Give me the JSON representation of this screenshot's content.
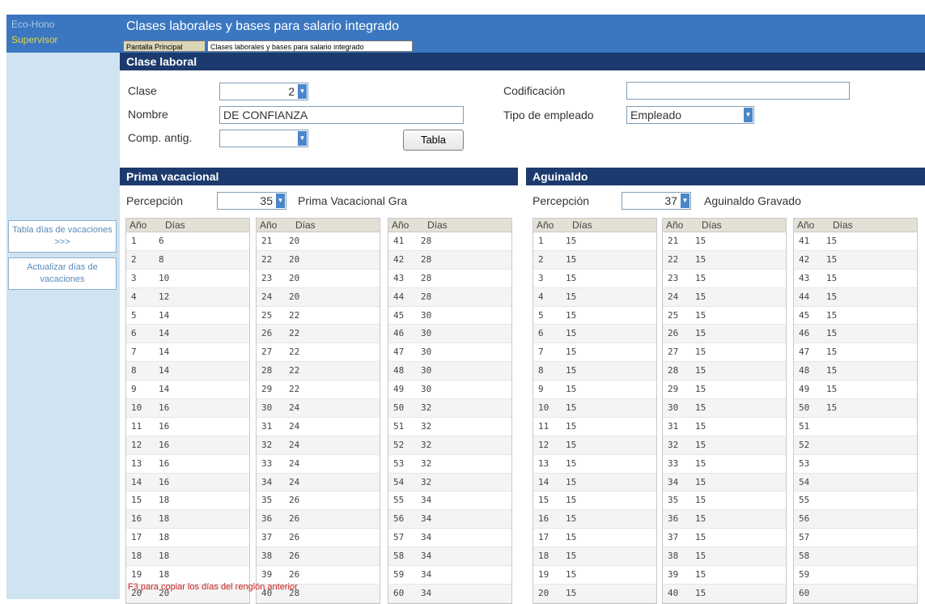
{
  "sidebar": {
    "app_name": "Eco-Hono",
    "user_role": "Supervisor",
    "buttons": [
      "Tabla días de vacaciones >>>",
      "Actualizar días de vacaciones"
    ]
  },
  "window": {
    "title": "Clases laborales y bases para salario integrado",
    "tabs": [
      "Pantalla Principal",
      "Clases laborales y bases para salario integrado"
    ]
  },
  "clase_laboral": {
    "header": "Clase laboral",
    "labels": {
      "clase": "Clase",
      "nombre": "Nombre",
      "comp_antig": "Comp. antig.",
      "codificacion": "Codificación",
      "tipo_empleado": "Tipo de empleado"
    },
    "values": {
      "clase": "2",
      "nombre": "DE CONFIANZA",
      "comp_antig": "",
      "codificacion": "",
      "tipo_empleado": "Empleado"
    },
    "tabla_button": "Tabla"
  },
  "prima_vacacional": {
    "header": "Prima vacacional",
    "percepcion_label": "Percepción",
    "percepcion_value": "35",
    "percepcion_name": "Prima Vacacional Gra",
    "col_headers": [
      "Año",
      "Días"
    ],
    "columns": [
      [
        [
          "1",
          "6"
        ],
        [
          "2",
          "8"
        ],
        [
          "3",
          "10"
        ],
        [
          "4",
          "12"
        ],
        [
          "5",
          "14"
        ],
        [
          "6",
          "14"
        ],
        [
          "7",
          "14"
        ],
        [
          "8",
          "14"
        ],
        [
          "9",
          "14"
        ],
        [
          "10",
          "16"
        ],
        [
          "11",
          "16"
        ],
        [
          "12",
          "16"
        ],
        [
          "13",
          "16"
        ],
        [
          "14",
          "16"
        ],
        [
          "15",
          "18"
        ],
        [
          "16",
          "18"
        ],
        [
          "17",
          "18"
        ],
        [
          "18",
          "18"
        ],
        [
          "19",
          "18"
        ],
        [
          "20",
          "20"
        ]
      ],
      [
        [
          "21",
          "20"
        ],
        [
          "22",
          "20"
        ],
        [
          "23",
          "20"
        ],
        [
          "24",
          "20"
        ],
        [
          "25",
          "22"
        ],
        [
          "26",
          "22"
        ],
        [
          "27",
          "22"
        ],
        [
          "28",
          "22"
        ],
        [
          "29",
          "22"
        ],
        [
          "30",
          "24"
        ],
        [
          "31",
          "24"
        ],
        [
          "32",
          "24"
        ],
        [
          "33",
          "24"
        ],
        [
          "34",
          "24"
        ],
        [
          "35",
          "26"
        ],
        [
          "36",
          "26"
        ],
        [
          "37",
          "26"
        ],
        [
          "38",
          "26"
        ],
        [
          "39",
          "26"
        ],
        [
          "40",
          "28"
        ]
      ],
      [
        [
          "41",
          "28"
        ],
        [
          "42",
          "28"
        ],
        [
          "43",
          "28"
        ],
        [
          "44",
          "28"
        ],
        [
          "45",
          "30"
        ],
        [
          "46",
          "30"
        ],
        [
          "47",
          "30"
        ],
        [
          "48",
          "30"
        ],
        [
          "49",
          "30"
        ],
        [
          "50",
          "32"
        ],
        [
          "51",
          "32"
        ],
        [
          "52",
          "32"
        ],
        [
          "53",
          "32"
        ],
        [
          "54",
          "32"
        ],
        [
          "55",
          "34"
        ],
        [
          "56",
          "34"
        ],
        [
          "57",
          "34"
        ],
        [
          "58",
          "34"
        ],
        [
          "59",
          "34"
        ],
        [
          "60",
          "34"
        ]
      ]
    ]
  },
  "aguinaldo": {
    "header": "Aguinaldo",
    "percepcion_label": "Percepción",
    "percepcion_value": "37",
    "percepcion_name": "Aguinaldo Gravado",
    "col_headers": [
      "Año",
      "Días"
    ],
    "columns": [
      [
        [
          "1",
          "15"
        ],
        [
          "2",
          "15"
        ],
        [
          "3",
          "15"
        ],
        [
          "4",
          "15"
        ],
        [
          "5",
          "15"
        ],
        [
          "6",
          "15"
        ],
        [
          "7",
          "15"
        ],
        [
          "8",
          "15"
        ],
        [
          "9",
          "15"
        ],
        [
          "10",
          "15"
        ],
        [
          "11",
          "15"
        ],
        [
          "12",
          "15"
        ],
        [
          "13",
          "15"
        ],
        [
          "14",
          "15"
        ],
        [
          "15",
          "15"
        ],
        [
          "16",
          "15"
        ],
        [
          "17",
          "15"
        ],
        [
          "18",
          "15"
        ],
        [
          "19",
          "15"
        ],
        [
          "20",
          "15"
        ]
      ],
      [
        [
          "21",
          "15"
        ],
        [
          "22",
          "15"
        ],
        [
          "23",
          "15"
        ],
        [
          "24",
          "15"
        ],
        [
          "25",
          "15"
        ],
        [
          "26",
          "15"
        ],
        [
          "27",
          "15"
        ],
        [
          "28",
          "15"
        ],
        [
          "29",
          "15"
        ],
        [
          "30",
          "15"
        ],
        [
          "31",
          "15"
        ],
        [
          "32",
          "15"
        ],
        [
          "33",
          "15"
        ],
        [
          "34",
          "15"
        ],
        [
          "35",
          "15"
        ],
        [
          "36",
          "15"
        ],
        [
          "37",
          "15"
        ],
        [
          "38",
          "15"
        ],
        [
          "39",
          "15"
        ],
        [
          "40",
          "15"
        ]
      ],
      [
        [
          "41",
          "15"
        ],
        [
          "42",
          "15"
        ],
        [
          "43",
          "15"
        ],
        [
          "44",
          "15"
        ],
        [
          "45",
          "15"
        ],
        [
          "46",
          "15"
        ],
        [
          "47",
          "15"
        ],
        [
          "48",
          "15"
        ],
        [
          "49",
          "15"
        ],
        [
          "50",
          "15"
        ],
        [
          "51",
          ""
        ],
        [
          "52",
          ""
        ],
        [
          "53",
          ""
        ],
        [
          "54",
          ""
        ],
        [
          "55",
          ""
        ],
        [
          "56",
          ""
        ],
        [
          "57",
          ""
        ],
        [
          "58",
          ""
        ],
        [
          "59",
          ""
        ],
        [
          "60",
          ""
        ]
      ]
    ]
  },
  "footer_note": "F3 para copiar los días del renglón anterior",
  "colors": {
    "title_bar": "#3a77c0",
    "section_header": "#1c3a6d",
    "sidebar_bg": "#cfe3f1",
    "note_red": "#cc2222"
  }
}
